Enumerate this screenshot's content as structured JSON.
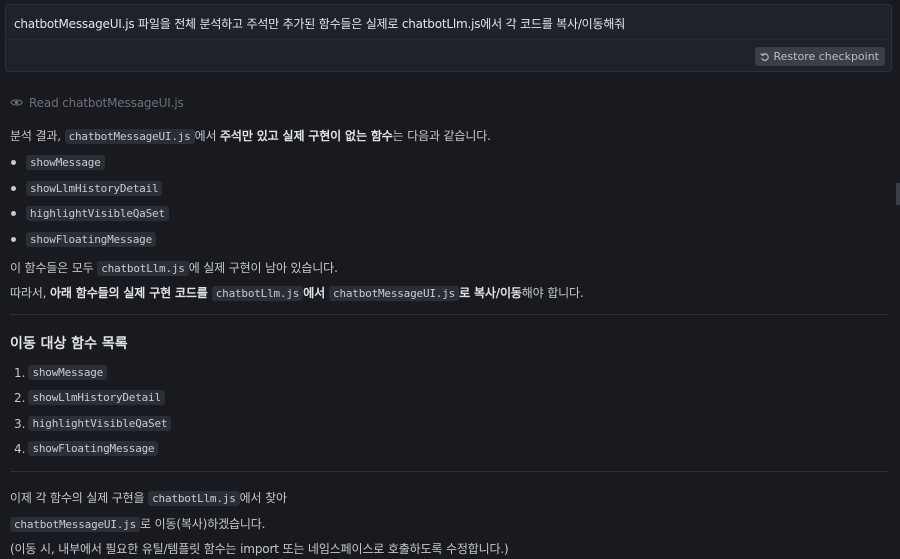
{
  "prompt": {
    "text": "chatbotMessageUI.js 파일을 전체 분석하고 주석만 추가된 함수들은 실제로 chatbotLlm.js에서 각 코드를 복사/이동해줘",
    "restore_label": "Restore checkpoint"
  },
  "read_action": {
    "label": "Read chatbotMessageUI.js"
  },
  "analysis": {
    "intro_prefix": "분석 결과, ",
    "intro_code": "chatbotMessageUI.js",
    "intro_mid": "에서 ",
    "intro_bold": "주석만 있고 실제 구현이 없는 함수",
    "intro_suffix": "는 다음과 같습니다.",
    "functions": [
      "showMessage",
      "showLlmHistoryDetail",
      "highlightVisibleQaSet",
      "showFloatingMessage"
    ],
    "remain_prefix": "이 함수들은 모두 ",
    "remain_code": "chatbotLlm.js",
    "remain_suffix": "에 실제 구현이 남아 있습니다.",
    "therefore_prefix": "따라서, ",
    "therefore_bold1": "아래 함수들의 실제 구현 코드를 ",
    "therefore_code1": "chatbotLlm.js",
    "therefore_bold2": "에서 ",
    "therefore_code2": "chatbotMessageUI.js",
    "therefore_bold3": "로 복사/이동",
    "therefore_suffix": "해야 합니다."
  },
  "section": {
    "heading": "이동 대상 함수 목록",
    "items": [
      {
        "num": "1.",
        "name": "showMessage"
      },
      {
        "num": "2.",
        "name": "showLlmHistoryDetail"
      },
      {
        "num": "3.",
        "name": "highlightVisibleQaSet"
      },
      {
        "num": "4.",
        "name": "showFloatingMessage"
      }
    ]
  },
  "closing": {
    "line1_prefix": "이제 각 함수의 실제 구현을 ",
    "line1_code": "chatbotLlm.js",
    "line1_suffix": "에서 찾아",
    "line2_code": "chatbotMessageUI.js",
    "line2_suffix": "로 이동(복사)하겠습니다.",
    "line3": "(이동 시, 내부에서 필요한 유틸/템플릿 함수는 import 또는 네임스페이스로 호출하도록 수정합니다.)"
  }
}
